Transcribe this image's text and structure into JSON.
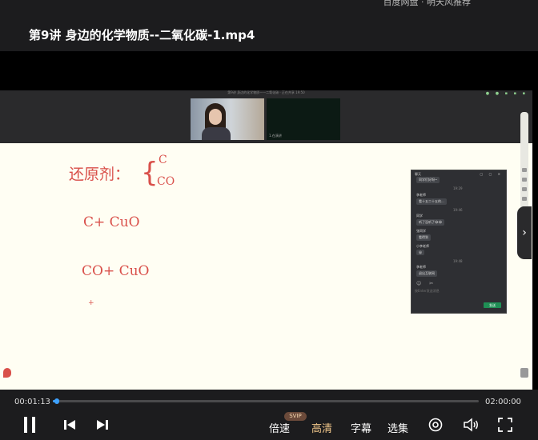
{
  "header": {
    "brand_text": "百度网盘 · 明天风推荐",
    "video_title": "第9讲 身边的化学物质--二氧化碳-1.mp4"
  },
  "meeting": {
    "caption": "第9讲 身边的化学物质——二氧化碳 · 正在共享 19:50",
    "tile2_label": "1.在演讲"
  },
  "board": {
    "line1_label": "还原剂：",
    "line1_options": [
      "C",
      "CO"
    ],
    "line2": "C+ CuO",
    "line3": "CO+ CuO",
    "cursor": "+"
  },
  "chat": {
    "title": "聊天",
    "messages": [
      {
        "text": "同学们好呀~",
        "type": "bubble"
      },
      {
        "text": "19:29",
        "type": "time"
      },
      {
        "text": "李老师",
        "type": "name"
      },
      {
        "text": "看十五二十五的...",
        "type": "bubble"
      },
      {
        "text": "19:46",
        "type": "time"
      },
      {
        "text": "同学",
        "type": "name"
      },
      {
        "text": "听了没听了😂😂",
        "type": "bubble"
      },
      {
        "text": "张同学",
        "type": "name"
      },
      {
        "text": "看得到",
        "type": "bubble"
      },
      {
        "text": "小李老师",
        "type": "name"
      },
      {
        "text": "😀",
        "type": "bubble"
      },
      {
        "text": "19:48",
        "type": "time"
      },
      {
        "text": "李老师",
        "type": "name"
      },
      {
        "text": "退出互联网",
        "type": "bubble"
      }
    ],
    "input_placeholder": "按Enter发送消息",
    "send_label": "发送"
  },
  "player": {
    "current_time": "00:01:13",
    "duration": "02:00:00",
    "progress_fraction": 0.01,
    "speed_label": "倍速",
    "svip_badge": "SVIP",
    "quality_label": "高清",
    "subtitle_label": "字幕",
    "episodes_label": "选集",
    "accent_color": "#3da1ff",
    "quality_color": "#f0c68a"
  }
}
